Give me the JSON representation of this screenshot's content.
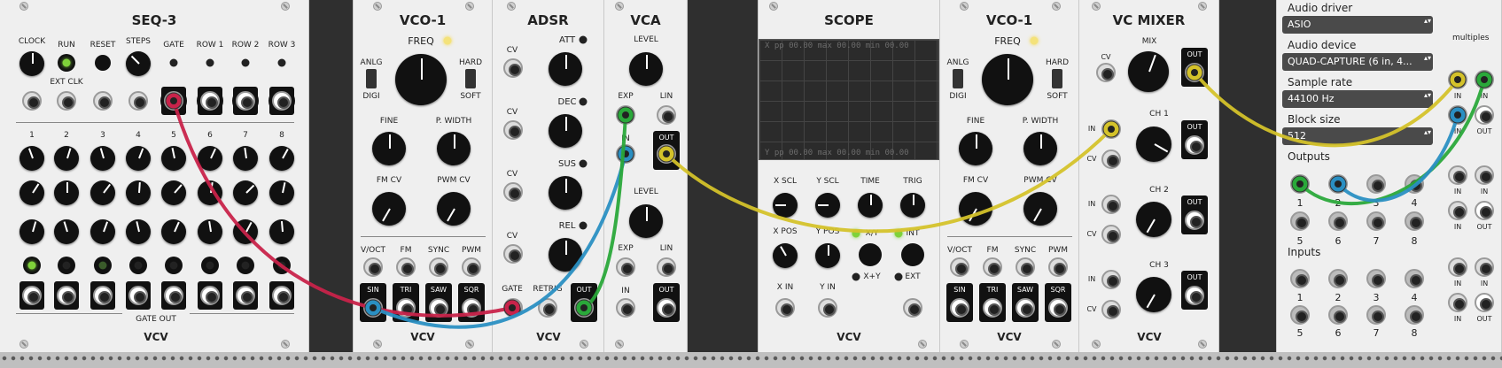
{
  "seq3": {
    "title": "SEQ-3",
    "clock": "CLOCK",
    "run": "RUN",
    "reset": "RESET",
    "steps": "STEPS",
    "ext_clk": "EXT CLK",
    "gate": "GATE",
    "row1": "ROW 1",
    "row2": "ROW 2",
    "row3": "ROW 3",
    "step_numbers": [
      "1",
      "2",
      "3",
      "4",
      "5",
      "6",
      "7",
      "8"
    ],
    "gate_out": "GATE OUT",
    "logo": "VCV"
  },
  "vco1a": {
    "title": "VCO-1",
    "freq": "FREQ",
    "anlg": "ANLG",
    "digi": "DIGI",
    "hard": "HARD",
    "soft": "SOFT",
    "fine": "FINE",
    "pwidth": "P. WIDTH",
    "fmcv": "FM CV",
    "pwmcv": "PWM CV",
    "voct": "V/OCT",
    "fm": "FM",
    "sync": "SYNC",
    "pwm": "PWM",
    "sin": "SIN",
    "tri": "TRI",
    "saw": "SAW",
    "sqr": "SQR",
    "logo": "VCV"
  },
  "adsr": {
    "title": "ADSR",
    "cv": "CV",
    "att": "ATT",
    "dec": "DEC",
    "sus": "SUS",
    "rel": "REL",
    "gate": "GATE",
    "retrig": "RETRIG",
    "out": "OUT",
    "logo": "VCV"
  },
  "vca": {
    "title": "VCA",
    "level": "LEVEL",
    "exp": "EXP",
    "lin": "LIN",
    "in": "IN",
    "out": "OUT"
  },
  "scope": {
    "title": "SCOPE",
    "top_readout": "X  pp  00.00  max  00.00  min  00.00",
    "bottom_readout": "Y  pp  00.00  max  00.00  min  00.00",
    "xscl": "X SCL",
    "yscl": "Y SCL",
    "time": "TIME",
    "trig": "TRIG",
    "xpos": "X POS",
    "ypos": "Y POS",
    "xy": "X/Y",
    "xpy": "X+Y",
    "int": "INT",
    "ext": "EXT",
    "xin": "X IN",
    "yin": "Y IN",
    "logo": "VCV"
  },
  "vco1b": {
    "title": "VCO-1",
    "freq": "FREQ",
    "anlg": "ANLG",
    "digi": "DIGI",
    "hard": "HARD",
    "soft": "SOFT",
    "fine": "FINE",
    "pwidth": "P. WIDTH",
    "fmcv": "FM CV",
    "pwmcv": "PWM CV",
    "voct": "V/OCT",
    "fm": "FM",
    "sync": "SYNC",
    "pwm": "PWM",
    "sin": "SIN",
    "tri": "TRI",
    "saw": "SAW",
    "sqr": "SQR",
    "logo": "VCV"
  },
  "mixer": {
    "title": "VC MIXER",
    "mix": "MIX",
    "cv": "CV",
    "in": "IN",
    "out": "OUT",
    "ch1": "CH 1",
    "ch2": "CH 2",
    "ch3": "CH 3",
    "logo": "VCV"
  },
  "audio": {
    "driver_label": "Audio driver",
    "driver": "ASIO",
    "device_label": "Audio device",
    "device": "QUAD-CAPTURE (6 in, 4...",
    "rate_label": "Sample rate",
    "rate": "44100 Hz",
    "block_label": "Block size",
    "block": "512",
    "outputs": "Outputs",
    "inputs": "Inputs",
    "nums_top": [
      "1",
      "2",
      "3",
      "4"
    ],
    "nums_bot": [
      "5",
      "6",
      "7",
      "8"
    ]
  },
  "mult": {
    "title": "multiples",
    "in": "IN",
    "out": "OUT"
  },
  "cables": {
    "red": "#c8234a",
    "blue": "#2a8fc2",
    "green": "#2aa83a",
    "yellow": "#d4c22a"
  }
}
